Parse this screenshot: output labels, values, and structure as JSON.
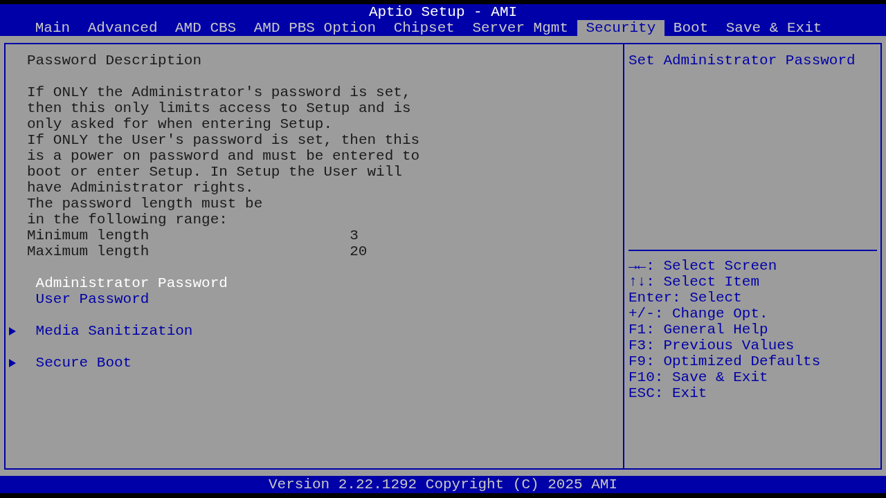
{
  "window": {
    "title": "Aptio Setup - AMI"
  },
  "tabs": [
    {
      "label": "Main",
      "selected": false
    },
    {
      "label": "Advanced",
      "selected": false
    },
    {
      "label": "AMD CBS",
      "selected": false
    },
    {
      "label": "AMD PBS Option",
      "selected": false
    },
    {
      "label": "Chipset",
      "selected": false
    },
    {
      "label": "Server Mgmt",
      "selected": false
    },
    {
      "label": "Security",
      "selected": true
    },
    {
      "label": "Boot",
      "selected": false
    },
    {
      "label": "Save & Exit",
      "selected": false
    }
  ],
  "main": {
    "heading": "Password Description",
    "description": [
      "If ONLY the Administrator's password is set,",
      "then this only limits access to Setup and is",
      "only asked for when entering Setup.",
      "If ONLY the User's password is set, then this",
      "is a power on password and must be entered to",
      "boot or enter Setup. In Setup the User will",
      "have Administrator rights.",
      "The password length must be",
      "in the following range:"
    ],
    "settings": [
      {
        "label": "Minimum length",
        "value": "3"
      },
      {
        "label": "Maximum length",
        "value": "20"
      }
    ],
    "items": [
      {
        "kind": "option",
        "label": "Administrator Password",
        "selected": true
      },
      {
        "kind": "option",
        "label": "User Password",
        "selected": false
      },
      {
        "kind": "submenu",
        "label": "Media Sanitization",
        "selected": false
      },
      {
        "kind": "submenu",
        "label": "Secure Boot",
        "selected": false
      }
    ]
  },
  "help": {
    "text": "Set Administrator Password",
    "keys": [
      "→←: Select Screen",
      "↑↓: Select Item",
      "Enter: Select",
      "+/-: Change Opt.",
      "F1: General Help",
      "F3: Previous Values",
      "F9: Optimized Defaults",
      "F10: Save & Exit",
      "ESC: Exit"
    ]
  },
  "status_bar": "Version 2.22.1292 Copyright (C) 2025 AMI"
}
